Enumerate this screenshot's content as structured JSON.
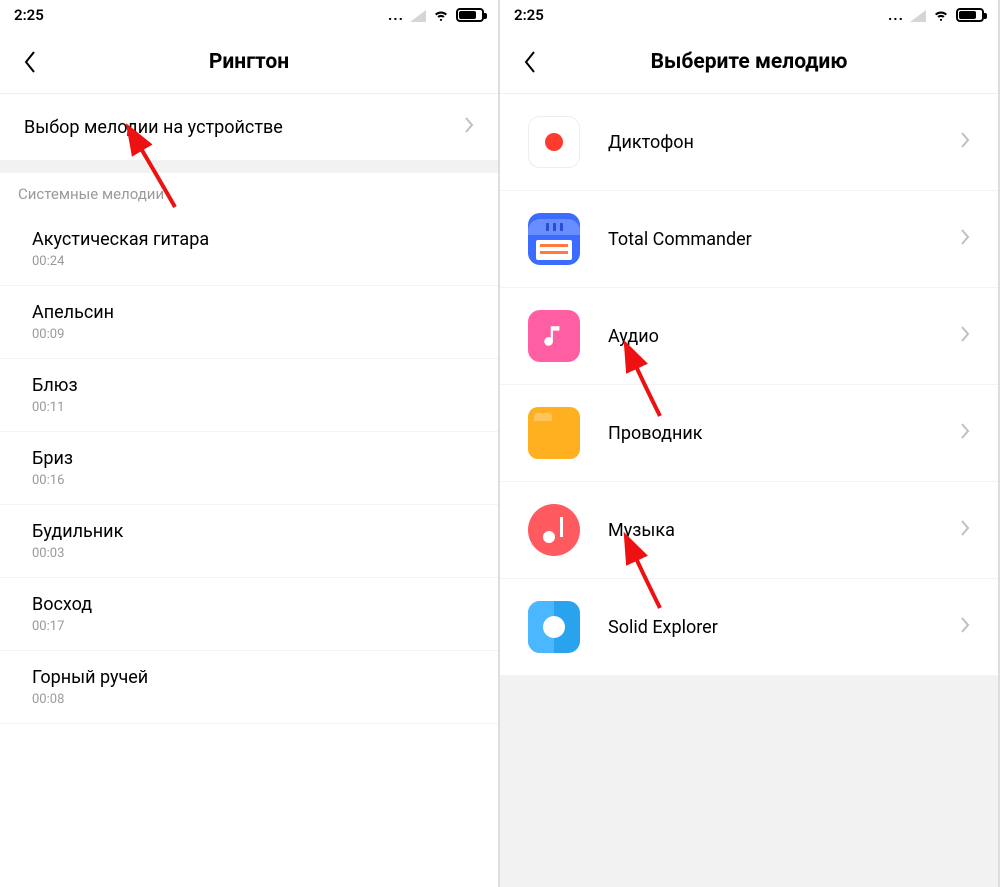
{
  "status": {
    "time": "2:25"
  },
  "left": {
    "title": "Рингтон",
    "select_on_device": "Выбор мелодии на устройстве",
    "section_header": "Системные мелодии",
    "melodies": [
      {
        "name": "Акустическая гитара",
        "dur": "00:24"
      },
      {
        "name": "Апельсин",
        "dur": "00:09"
      },
      {
        "name": "Блюз",
        "dur": "00:11"
      },
      {
        "name": "Бриз",
        "dur": "00:16"
      },
      {
        "name": "Будильник",
        "dur": "00:03"
      },
      {
        "name": "Восход",
        "dur": "00:17"
      },
      {
        "name": "Горный ручей",
        "dur": "00:08"
      }
    ]
  },
  "right": {
    "title": "Выберите мелодию",
    "apps": [
      {
        "name": "Диктофон",
        "icon": "recorder"
      },
      {
        "name": "Total Commander",
        "icon": "save"
      },
      {
        "name": "Аудио",
        "icon": "audio"
      },
      {
        "name": "Проводник",
        "icon": "folder"
      },
      {
        "name": "Музыка",
        "icon": "music"
      },
      {
        "name": "Solid Explorer",
        "icon": "solid"
      }
    ]
  }
}
